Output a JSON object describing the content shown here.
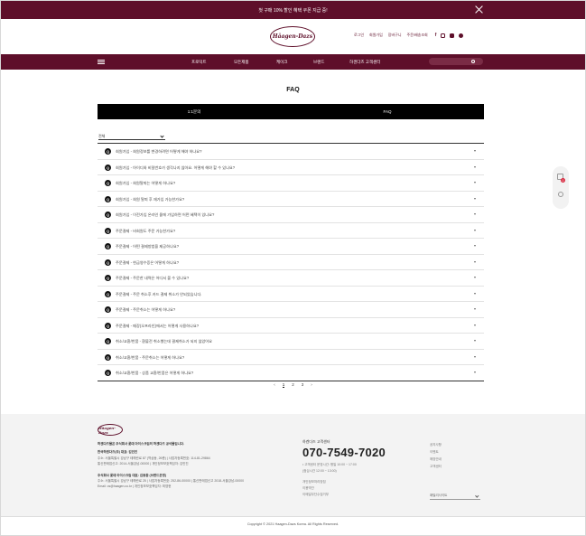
{
  "promo": {
    "text": "첫 구매 10% 할인 혜택 쿠폰 지급 중!"
  },
  "header": {
    "logo": "Häagen-Dazs",
    "utils": [
      "로그인",
      "회원가입",
      "장바구니",
      "주문/배송조회"
    ],
    "sns": [
      "f",
      "instagram",
      "youtube",
      "blog"
    ]
  },
  "nav": {
    "items": [
      "프로덕트",
      "모든제품",
      "케이크",
      "브랜드",
      "하겐다즈 고객센터"
    ],
    "search_placeholder": ""
  },
  "page": {
    "title": "FAQ"
  },
  "tabs": [
    {
      "label": "1:1문의"
    },
    {
      "label": "FAQ"
    }
  ],
  "filter": {
    "selected": "전체"
  },
  "faq": {
    "badge": "Q",
    "items": [
      "회원가입 - 회원정보를 변경하려면 어떻게 해야 하나요?",
      "회원가입 - 아이디와 비밀번호가 생각나지 않아요. 어떻게 해야 할 수 있나요?",
      "회원가입 - 회원탈퇴는 어떻게 하나요?",
      "회원가입 - 회원 탈퇴 후 재가입 가능한가요?",
      "회원가입 - 이전가입 온라인 몰에 가입하면 어떤 혜택이 있나요?",
      "주문결제 - 비회원도 주문 가능한가요?",
      "주문결제 - 어떤 결제방법을 제공하나요?",
      "주문결제 - 현금영수증은 어떻게 하나요?",
      "주문결제 - 주문한 내역은 어디서 볼 수 있나요?",
      "주문결제 - 주문 취소후 카드 결제 취소가 안되었습니다.",
      "주문결제 - 주문취소는 어떻게 하나요?",
      "주문결제 - 매장(오프라인)에서는 어떻게 사용하나요?",
      "취소/교환/반품 - 환불전 취소했는데 결제취소가 되지 않았어요",
      "취소/교환/반품 - 주문취소는 어떻게 하나요?",
      "취소/교환/반품 - 상품 교환/반품은 어떻게 하나요?"
    ]
  },
  "pagination": {
    "prev": "‹",
    "pages": [
      "1",
      "2",
      "3"
    ],
    "active": "1",
    "next": "›"
  },
  "floater": {
    "cart_count": "0"
  },
  "footer": {
    "logo": "Häagen-Dazs",
    "notice": "하겐다즈몰은 주식회사 롯데 아이스크림의 하겐다즈 공식몰입니다.",
    "company1_title": "한국하겐다즈(주) 대표: 김민진",
    "company1_lines": [
      "주소: 서울특별시 강남구 테헤란로 87 (역삼동, 26층) | 사업자등록번호: 114-81-29864",
      "통신판매업신고: 2014-서울강남-00000 | 개인정보보호책임자: 김민진"
    ],
    "company2_title": "주식회사 롯데 아이스크림 대표: 김동환 (브랜드운영)",
    "company2_lines": [
      "주소: 서울특별시 강남구 테헤란로 25 | 사업자등록번호: 252-86-00000 | 통신판매업신고 2018-서울강남-00000",
      "Email: cs@haagen.co.kr | 개인정보보호책임자: 최영현"
    ],
    "cs_title": "하겐다즈 고객센터",
    "phone": "070-7549-7020",
    "cs_lines": [
      "• 고객센터 운영시간: 평일 10:00 ~ 17:00",
      "(점심시간 12:00 ~ 13:00)",
      "개인정보처리방침",
      "이용약관",
      "이메일무단수집거부"
    ],
    "links": [
      "공지사항",
      "이벤트",
      "매장안내",
      "고객센터"
    ],
    "family_site": "패밀리사이트",
    "copyright": "Copyright © 2021 Haagen-Dazs Korea. All Rights Reserved."
  }
}
